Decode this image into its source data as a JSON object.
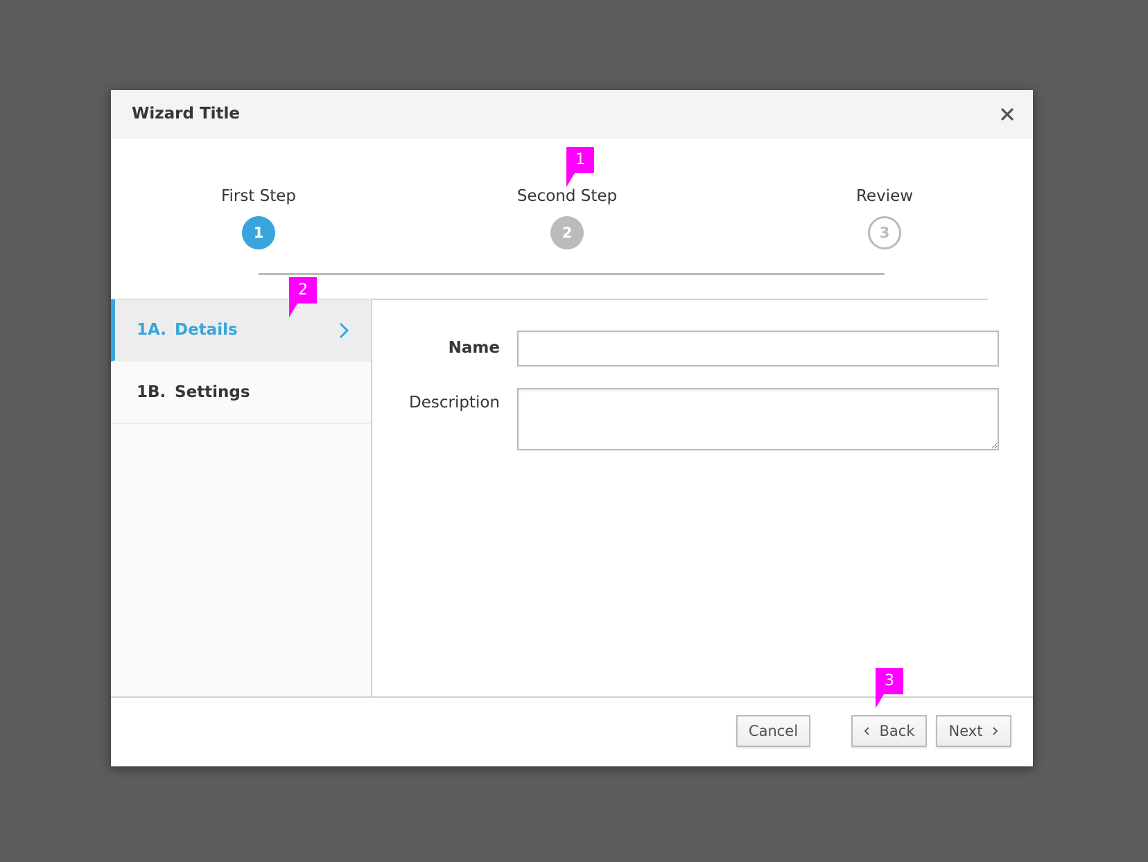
{
  "dialog": {
    "title": "Wizard Title",
    "close_icon": "close-icon"
  },
  "stepper": {
    "steps": [
      {
        "label": "First Step",
        "number": "1",
        "state": "active"
      },
      {
        "label": "Second Step",
        "number": "2",
        "state": "visited"
      },
      {
        "label": "Review",
        "number": "3",
        "state": "future"
      }
    ]
  },
  "sidebar": {
    "items": [
      {
        "number": "1A.",
        "label": "Details",
        "active": true,
        "icon": "chevron-right-icon"
      },
      {
        "number": "1B.",
        "label": "Settings",
        "active": false
      }
    ]
  },
  "form": {
    "name_label": "Name",
    "name_value": "",
    "description_label": "Description",
    "description_value": ""
  },
  "footer": {
    "cancel_label": "Cancel",
    "back_label": "Back",
    "next_label": "Next"
  },
  "callouts": [
    "1",
    "2",
    "3"
  ],
  "colors": {
    "accent": "#39a5dc",
    "callout": "#ff00ff",
    "backdrop": "#5c5c5c",
    "inactive_step": "#bbbbbb"
  }
}
